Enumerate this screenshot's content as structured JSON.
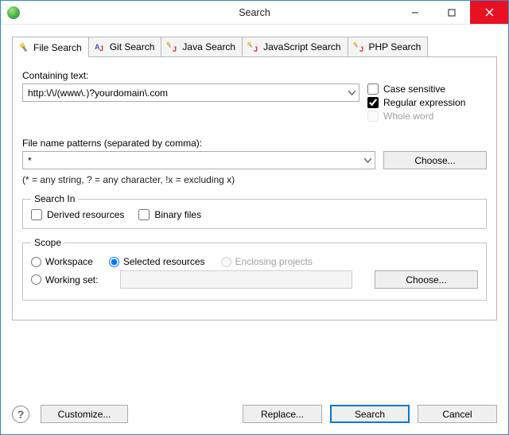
{
  "window": {
    "title": "Search"
  },
  "tabs": [
    {
      "label": "File Search",
      "icon": "flashlight"
    },
    {
      "label": "Git Search",
      "icon": "aj"
    },
    {
      "label": "Java Search",
      "icon": "flashlight-j"
    },
    {
      "label": "JavaScript Search",
      "icon": "flashlight-j"
    },
    {
      "label": "PHP Search",
      "icon": "flashlight-j"
    }
  ],
  "activeTab": 0,
  "fields": {
    "containing_label": "Containing text:",
    "containing_value": "http:\\/\\/(www\\.)?yourdomain\\.com",
    "case_sensitive": {
      "label": "Case sensitive",
      "checked": false
    },
    "regex": {
      "label": "Regular expression",
      "checked": true
    },
    "whole_word": {
      "label": "Whole word",
      "disabled": true
    },
    "patterns_label": "File name patterns (separated by comma):",
    "patterns_value": "*",
    "choose_btn": "Choose...",
    "hint": "(* = any string, ? = any character, !x = excluding x)"
  },
  "search_in": {
    "legend": "Search In",
    "derived": {
      "label": "Derived resources",
      "checked": false
    },
    "binary": {
      "label": "Binary files",
      "checked": false
    }
  },
  "scope": {
    "legend": "Scope",
    "workspace": "Workspace",
    "selected": "Selected resources",
    "enclosing": "Enclosing projects",
    "working_set": "Working set:",
    "choose": "Choose...",
    "value": "selected"
  },
  "footer": {
    "customize": "Customize...",
    "replace": "Replace...",
    "search": "Search",
    "cancel": "Cancel"
  }
}
